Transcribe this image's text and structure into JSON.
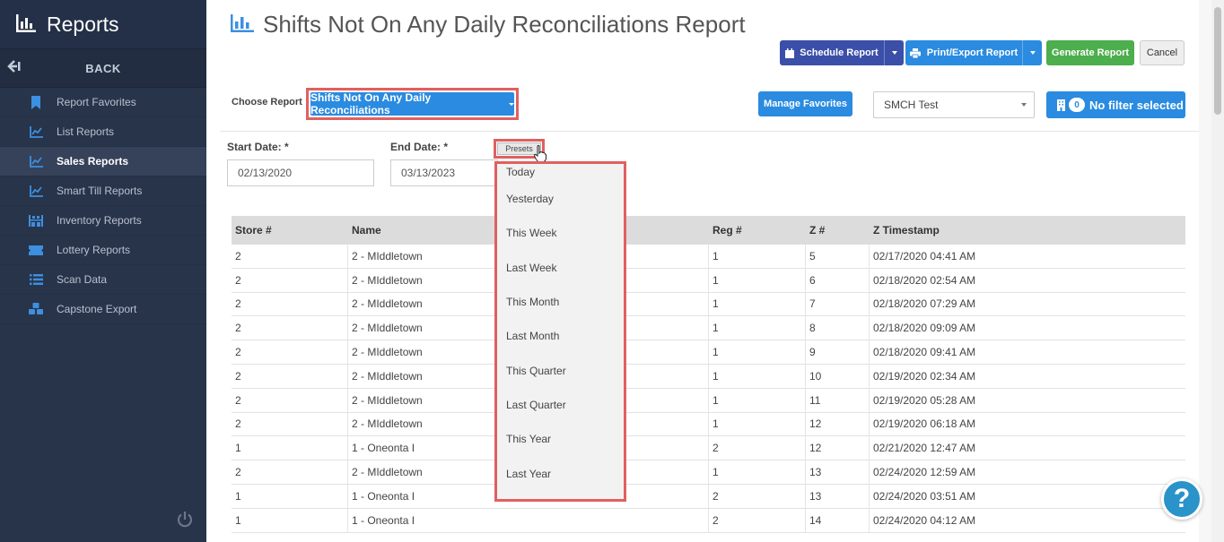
{
  "sidebar": {
    "title": "Reports",
    "back_label": "BACK",
    "items": [
      {
        "label": "Report Favorites",
        "icon": "bookmark-icon"
      },
      {
        "label": "List Reports",
        "icon": "line-chart-icon"
      },
      {
        "label": "Sales Reports",
        "icon": "line-chart-icon",
        "active": true
      },
      {
        "label": "Smart Till Reports",
        "icon": "line-chart-icon"
      },
      {
        "label": "Inventory Reports",
        "icon": "warehouse-icon"
      },
      {
        "label": "Lottery Reports",
        "icon": "ticket-icon"
      },
      {
        "label": "Scan Data",
        "icon": "list-icon"
      },
      {
        "label": "Capstone Export",
        "icon": "cubes-icon"
      }
    ]
  },
  "header": {
    "title": "Shifts Not On Any Daily Reconciliations Report"
  },
  "toolbar": {
    "schedule_label": "Schedule Report",
    "print_label": "Print/Export Report",
    "generate_label": "Generate Report",
    "cancel_label": "Cancel"
  },
  "filters": {
    "choose_label": "Choose Report",
    "report_selected": "Shifts Not On Any Daily Reconciliations",
    "favorites_label": "Manage Favorites",
    "store_selected": "SMCH Test",
    "filter_count": "0",
    "filter_label": "No filter selected",
    "start_label": "Start Date: *",
    "start_value": "02/13/2020",
    "end_label": "End Date: *",
    "end_value": "03/13/2023",
    "presets_label": "Presets"
  },
  "presets": [
    "Today",
    "Yesterday",
    "This Week",
    "Last Week",
    "This Month",
    "Last Month",
    "This Quarter",
    "Last Quarter",
    "This Year",
    "Last Year"
  ],
  "table": {
    "headers": [
      "Store #",
      "Name",
      "Reg #",
      "Z #",
      "Z Timestamp"
    ],
    "rows": [
      [
        "2",
        "2 - MIddletown",
        "1",
        "5",
        "02/17/2020 04:41 AM"
      ],
      [
        "2",
        "2 - MIddletown",
        "1",
        "6",
        "02/18/2020 02:54 AM"
      ],
      [
        "2",
        "2 - MIddletown",
        "1",
        "7",
        "02/18/2020 07:29 AM"
      ],
      [
        "2",
        "2 - MIddletown",
        "1",
        "8",
        "02/18/2020 09:09 AM"
      ],
      [
        "2",
        "2 - MIddletown",
        "1",
        "9",
        "02/18/2020 09:41 AM"
      ],
      [
        "2",
        "2 - MIddletown",
        "1",
        "10",
        "02/19/2020 02:34 AM"
      ],
      [
        "2",
        "2 - MIddletown",
        "1",
        "11",
        "02/19/2020 05:28 AM"
      ],
      [
        "2",
        "2 - MIddletown",
        "1",
        "12",
        "02/19/2020 06:18 AM"
      ],
      [
        "1",
        "1 - Oneonta I",
        "2",
        "12",
        "02/21/2020 12:47 AM"
      ],
      [
        "2",
        "2 - MIddletown",
        "1",
        "13",
        "02/24/2020 12:59 AM"
      ],
      [
        "1",
        "1 - Oneonta I",
        "2",
        "13",
        "02/24/2020 03:51 AM"
      ],
      [
        "1",
        "1 - Oneonta I",
        "2",
        "14",
        "02/24/2020 04:12 AM"
      ]
    ]
  },
  "help_label": "?"
}
